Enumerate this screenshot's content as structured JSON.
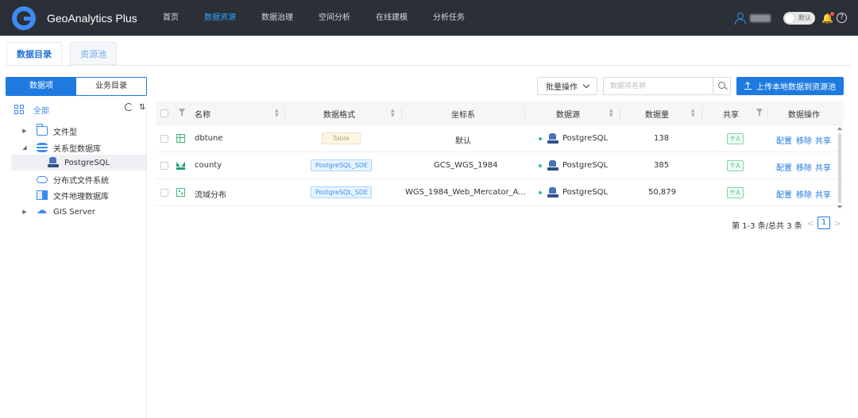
{
  "app": {
    "title": "GeoAnalytics Plus"
  },
  "nav": [
    "首页",
    "数据资源",
    "数据治理",
    "空间分析",
    "在线建模",
    "分析任务"
  ],
  "nav_active": 1,
  "topbar": {
    "toggle_label": "默认",
    "help_glyph": "?",
    "bell_glyph": "🔔"
  },
  "page_tabs": [
    "数据目录",
    "资源池"
  ],
  "segment": [
    "数据项",
    "业务目录"
  ],
  "tree": {
    "all_label": "全部",
    "nodes": [
      {
        "label": "文件型",
        "caret": "▶",
        "icon": "folder-icon"
      },
      {
        "label": "关系型数据库",
        "caret": "◢",
        "icon": "database-icon"
      },
      {
        "label": "PostgreSQL",
        "caret": "",
        "icon": "postgresql-icon"
      },
      {
        "label": "分布式文件系统",
        "caret": "",
        "icon": "cloud-storage-icon"
      },
      {
        "label": "文件地理数据库",
        "caret": "",
        "icon": "map-database-icon"
      },
      {
        "label": "GIS Server",
        "caret": "▶",
        "icon": "gis-server-icon"
      }
    ]
  },
  "toolbar": {
    "batch_label": "批量操作",
    "search_placeholder": "数据项名称",
    "upload_label": "上传本地数据到资源池"
  },
  "table": {
    "headers": {
      "name": "名称",
      "format": "数据格式",
      "crs": "坐标系",
      "source": "数据源",
      "count": "数据量",
      "share": "共享",
      "ops": "数据操作"
    },
    "rows": [
      {
        "name": "dbtune",
        "format": "Table",
        "crs": "默认",
        "source": "PostgreSQL",
        "count": "138",
        "share": "个人",
        "icon": "table-icon"
      },
      {
        "name": "county",
        "format": "PostgreSQL_SDE",
        "crs": "GCS_WGS_1984",
        "source": "PostgreSQL",
        "count": "385",
        "share": "个人",
        "icon": "polygon-layer-icon"
      },
      {
        "name": "流域分布",
        "format": "PostgreSQL_SDE",
        "crs": "WGS_1984_Web_Mercator_A...",
        "source": "PostgreSQL",
        "count": "50,879",
        "share": "个人",
        "icon": "raster-layer-icon"
      }
    ],
    "actions": [
      "配置",
      "移除",
      "共享"
    ]
  },
  "pagination": {
    "summary": "第 1-3 条/总共 3 条",
    "current": "1",
    "prev": "<",
    "next": ">"
  },
  "colors": {
    "topbar_bg": "#2b2f38",
    "accent": "#1f7ae0",
    "nav_active": "#2ea7ff",
    "share_green": "#27a862"
  }
}
